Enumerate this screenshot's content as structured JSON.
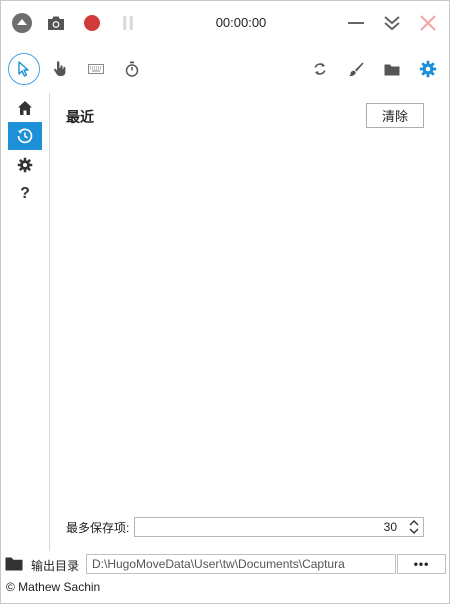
{
  "titlebar": {
    "timer": "00:00:00",
    "icons": [
      "menu-up-icon",
      "camera-icon",
      "record-icon",
      "pause-icon",
      "minimize-icon",
      "collapse-icon",
      "close-icon"
    ],
    "record_color": "#d03a3a"
  },
  "toolbar": {
    "left_tools": [
      "cursor-icon",
      "hand-icon",
      "keyboard-icon",
      "stopwatch-icon"
    ],
    "right_tools": [
      "refresh-icon",
      "brush-icon",
      "folder-icon",
      "settings-icon"
    ],
    "accent": "#1e90d7"
  },
  "sidebar": {
    "items": [
      "home-icon",
      "history-icon",
      "settings-icon",
      "help-icon"
    ],
    "active": "history-icon",
    "help_glyph": "?"
  },
  "main": {
    "title": "最近",
    "clear_label": "清除",
    "max_label": "最多保存项:",
    "max_value": "30"
  },
  "output": {
    "label": "输出目录",
    "path": "D:\\HugoMoveData\\User\\tw\\Documents\\Captura",
    "more_label": "•••"
  },
  "status": {
    "text": "© Mathew Sachin"
  }
}
